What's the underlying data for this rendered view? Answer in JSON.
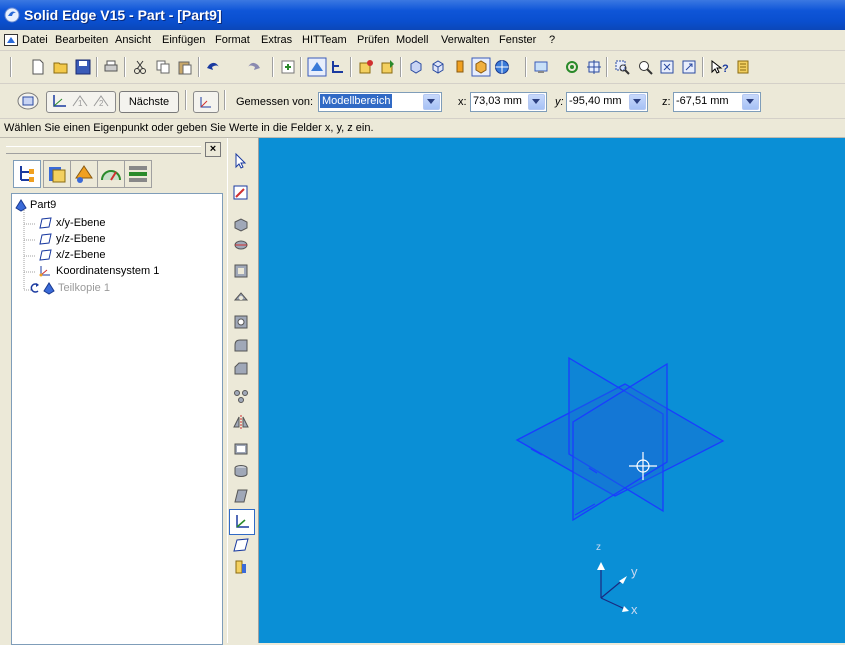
{
  "window": {
    "title": "Solid Edge V15 - Part - [Part9]"
  },
  "menu": [
    "Datei",
    "Bearbeiten",
    "Ansicht",
    "Einfügen",
    "Format",
    "Extras",
    "HITTeam",
    "Prüfen",
    "Modell",
    "Verwalten",
    "Fenster",
    "?"
  ],
  "ribbon": {
    "next_label": "Nächste",
    "measured_label": "Gemessen von:",
    "measured_value": "Modellbereich",
    "x_label": "x:",
    "x_value": "73,03 mm",
    "y_label": "y:",
    "y_value": "-95,40 mm",
    "z_label": "z:",
    "z_value": "-67,51 mm"
  },
  "prompt": "Wählen Sie einen Eigenpunkt oder geben Sie Werte in die Felder x, y, z ein.",
  "tree": {
    "root": "Part9",
    "items": [
      "x/y-Ebene",
      "y/z-Ebene",
      "x/z-Ebene",
      "Koordinatensystem 1",
      "Teilkopie 1"
    ]
  },
  "triad": {
    "z": "z",
    "y": "y",
    "x": "x"
  },
  "colors": {
    "viewport": "#0a8fd6",
    "geometry": "#1a3cff",
    "titlebar": "#0a4fcf"
  }
}
